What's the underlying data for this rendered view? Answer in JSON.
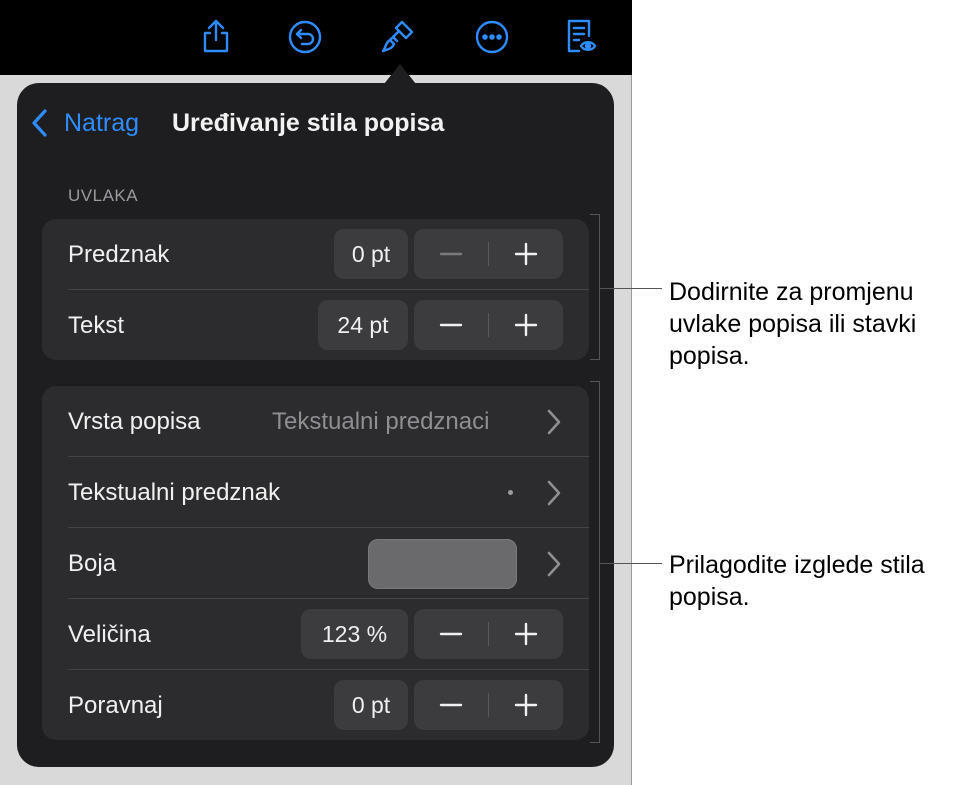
{
  "toolbar": {
    "icons": [
      "share-icon",
      "undo-icon",
      "format-brush-icon",
      "more-icon",
      "reading-view-icon"
    ],
    "accent": "#2f8cff"
  },
  "popover": {
    "back_label": "Natrag",
    "title": "Uređivanje stila popisa",
    "indent_section_label": "UVLAKA",
    "indent_rows": [
      {
        "label": "Predznak",
        "value": "0 pt"
      },
      {
        "label": "Tekst",
        "value": "24 pt"
      }
    ],
    "style_rows": {
      "list_type": {
        "label": "Vrsta popisa",
        "value": "Tekstualni predznaci"
      },
      "bullet": {
        "label": "Tekstualni predznak",
        "value": "•"
      },
      "color": {
        "label": "Boja",
        "swatch": "#6a6a6c"
      },
      "size": {
        "label": "Veličina",
        "value": "123 %"
      },
      "align": {
        "label": "Poravnaj",
        "value": "0 pt"
      }
    }
  },
  "callouts": {
    "indent": "Dodirnite za promjenu uvlake popisa ili stavki popisa.",
    "style": "Prilagodite izglede stila popisa."
  },
  "colors": {
    "popover_bg": "#1e1e20",
    "group_bg": "#2c2c2e",
    "accent": "#2f8cff"
  }
}
